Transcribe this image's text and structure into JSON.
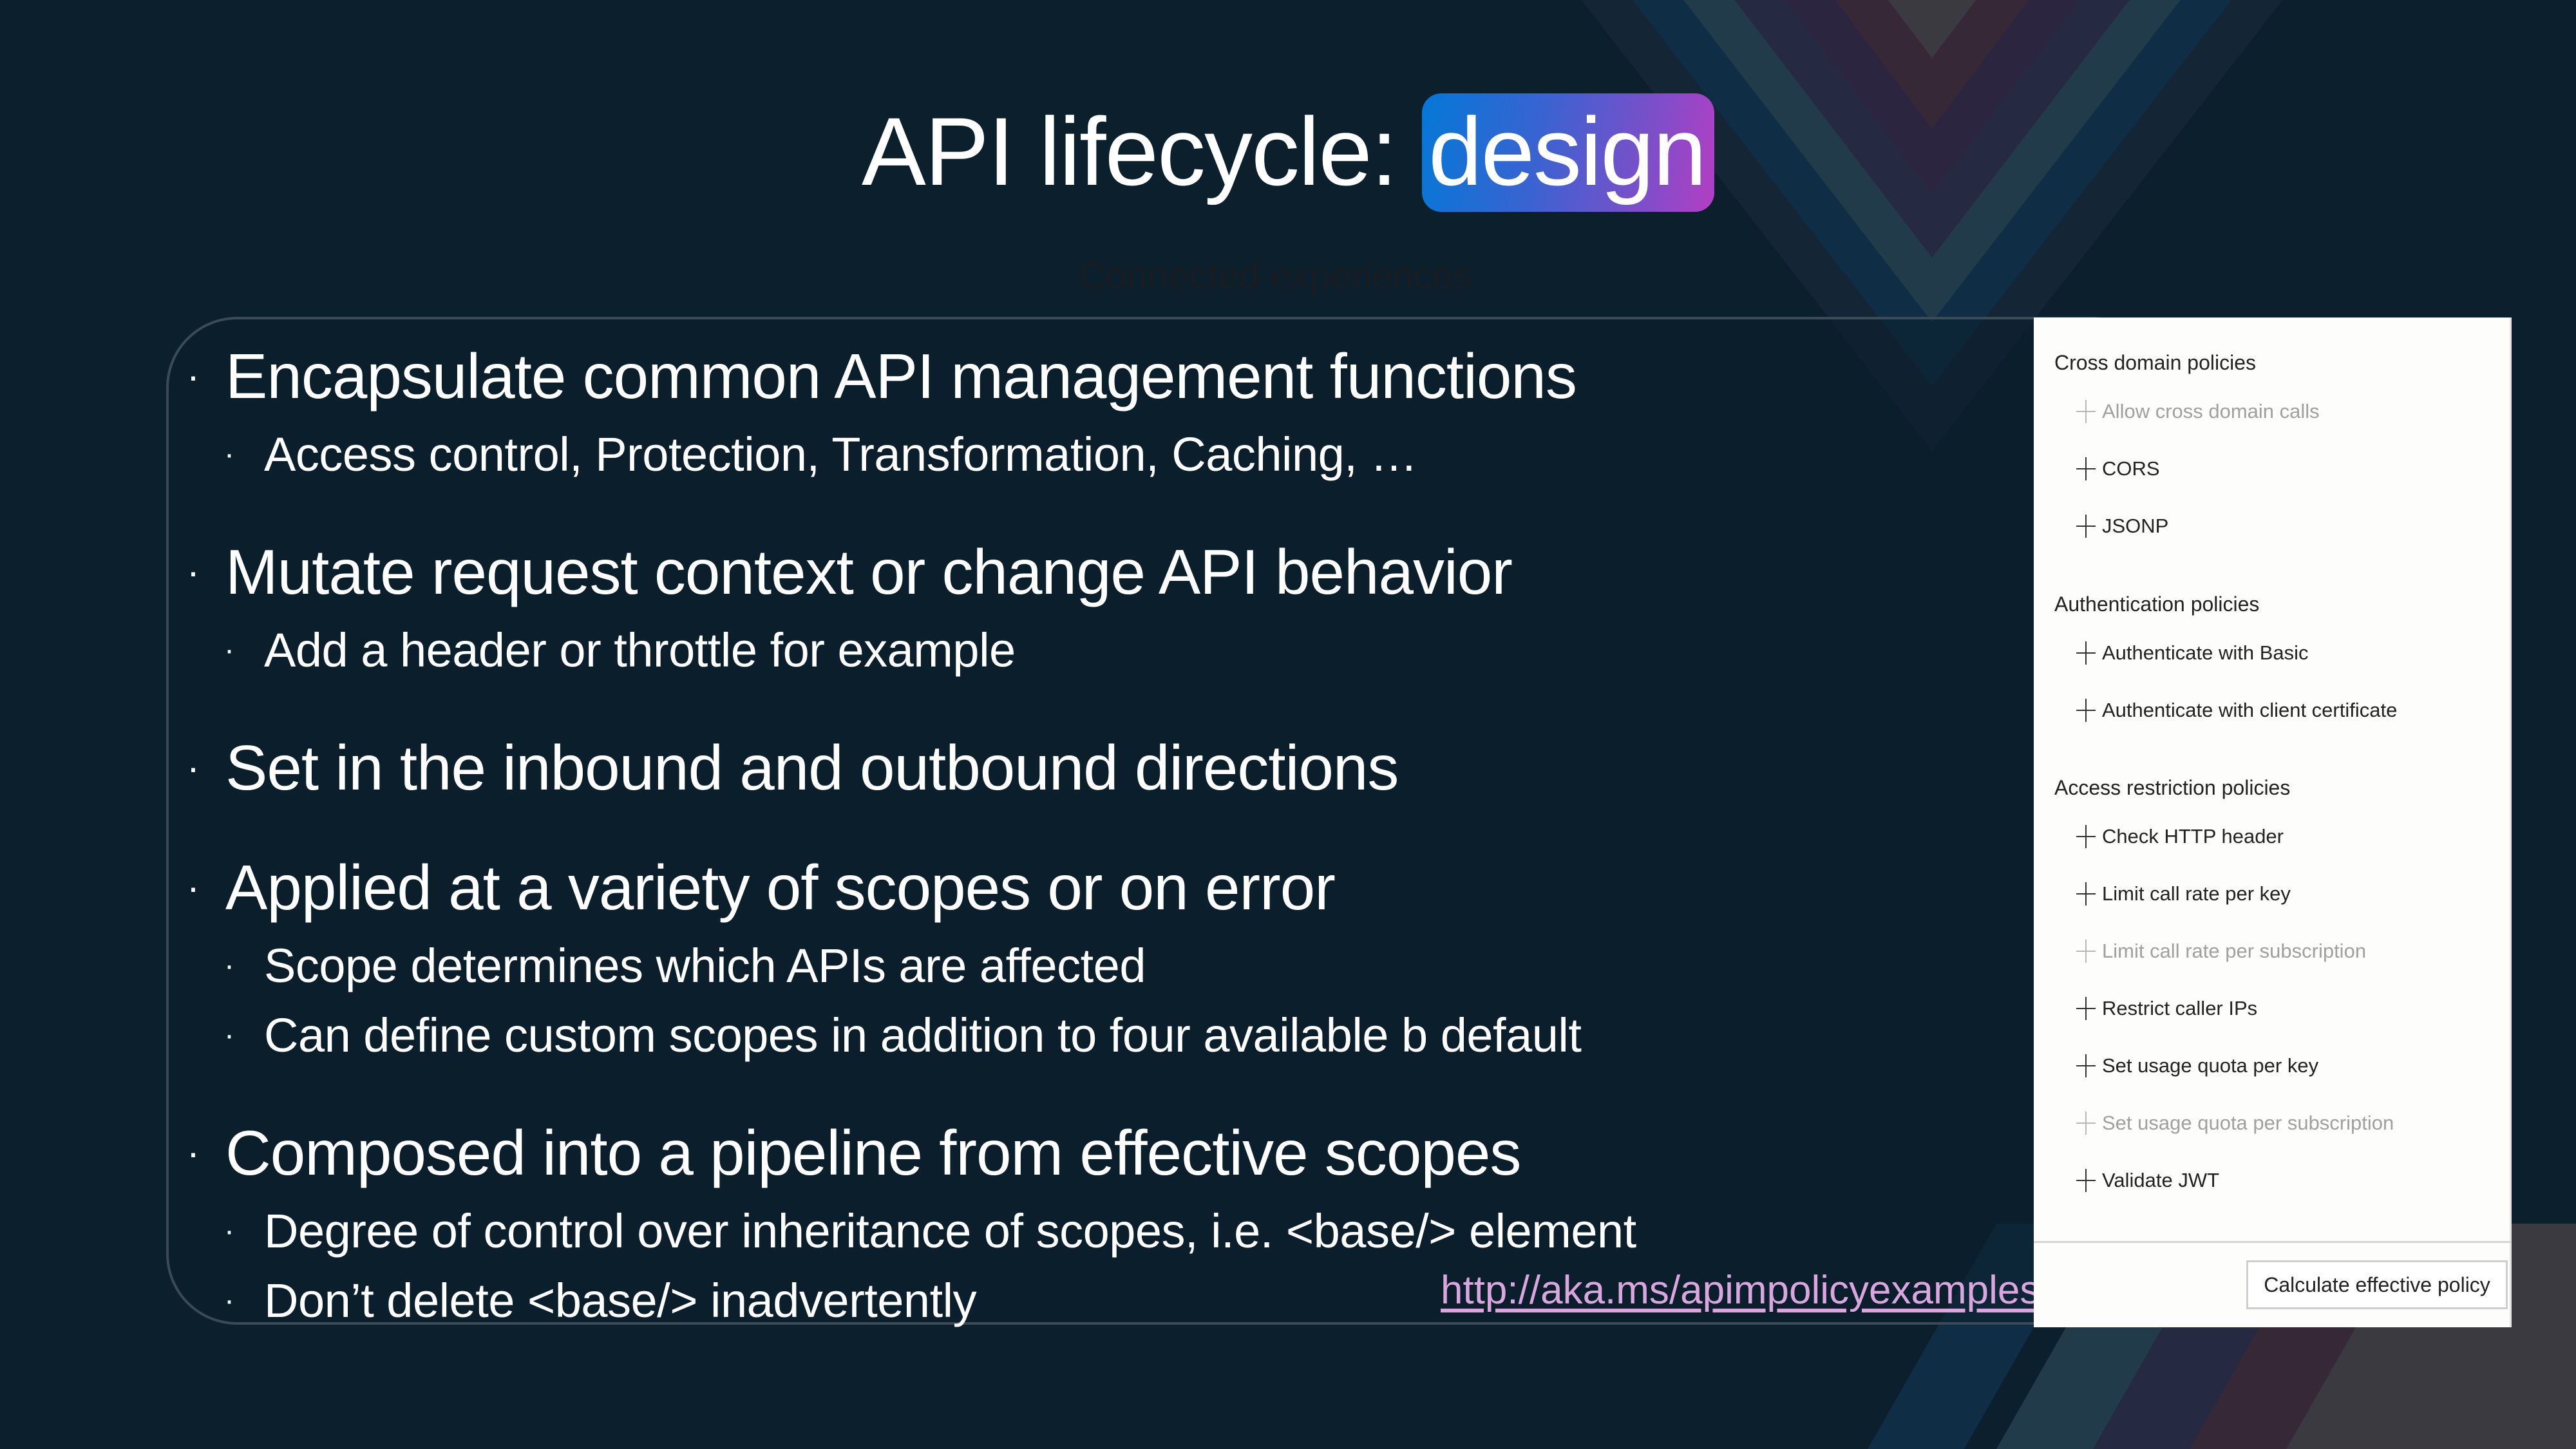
{
  "slide": {
    "title_prefix": "API lifecycle: ",
    "title_highlight": "design",
    "subtitle": "Connected experiences",
    "colors": {
      "background": "#0b1f2c",
      "highlight_gradient_start": "#0478d7",
      "highlight_gradient_end": "#b43ec4",
      "link": "#d9a6dd"
    }
  },
  "bullets": [
    {
      "text": "Encapsulate common API management functions",
      "sub": [
        "Access control, Protection, Transformation, Caching, …"
      ]
    },
    {
      "text": "Mutate request context or change API behavior",
      "sub": [
        "Add a header or throttle for example"
      ]
    },
    {
      "text": "Set in the inbound and outbound directions",
      "sub": []
    },
    {
      "text": "Applied at a variety of scopes or on error",
      "sub": [
        "Scope determines which APIs are affected",
        "Can define custom scopes in addition to four available b default"
      ]
    },
    {
      "text": "Composed into a pipeline from effective scopes",
      "sub": [
        "Degree of control over inheritance of scopes, i.e. <base/> element",
        "Don’t delete <base/> inadvertently"
      ]
    }
  ],
  "link": {
    "text": "http://aka.ms/apimpolicyexamples"
  },
  "bullet_glyph": "·",
  "policy_panel": {
    "sections": [
      {
        "title": "Cross domain policies",
        "items": [
          {
            "label": "Allow cross domain calls",
            "enabled": false,
            "icon": "plus-icon"
          },
          {
            "label": "CORS",
            "enabled": true,
            "icon": "plus-icon"
          },
          {
            "label": "JSONP",
            "enabled": true,
            "icon": "plus-icon"
          }
        ]
      },
      {
        "title": "Authentication policies",
        "items": [
          {
            "label": "Authenticate with Basic",
            "enabled": true,
            "icon": "plus-icon"
          },
          {
            "label": "Authenticate with client certificate",
            "enabled": true,
            "icon": "plus-icon"
          }
        ]
      },
      {
        "title": "Access restriction policies",
        "items": [
          {
            "label": "Check HTTP header",
            "enabled": true,
            "icon": "plus-icon"
          },
          {
            "label": "Limit call rate per key",
            "enabled": true,
            "icon": "plus-icon"
          },
          {
            "label": "Limit call rate per subscription",
            "enabled": false,
            "icon": "plus-icon"
          },
          {
            "label": "Restrict caller IPs",
            "enabled": true,
            "icon": "plus-icon"
          },
          {
            "label": "Set usage quota per key",
            "enabled": true,
            "icon": "plus-icon"
          },
          {
            "label": "Set usage quota per subscription",
            "enabled": false,
            "icon": "plus-icon"
          },
          {
            "label": "Validate JWT",
            "enabled": true,
            "icon": "plus-icon"
          }
        ]
      }
    ],
    "calculate_button_label": "Calculate effective policy"
  }
}
